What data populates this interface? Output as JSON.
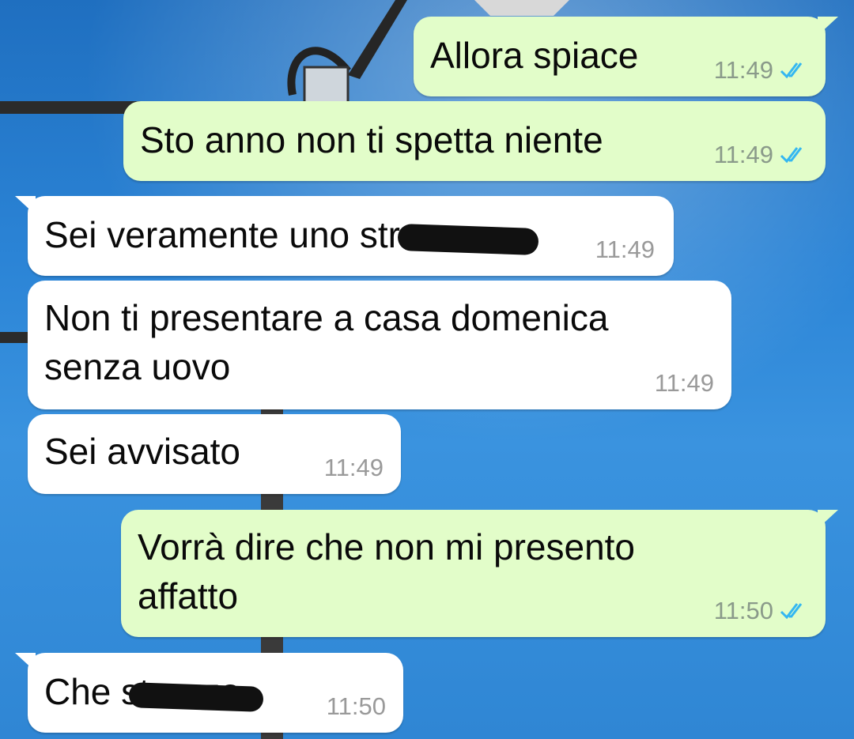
{
  "colors": {
    "outgoing_bubble": "#e2fdc9",
    "incoming_bubble": "#ffffff",
    "read_ticks": "#34b7f1",
    "wallpaper": "#2b84d6"
  },
  "messages": [
    {
      "direction": "out",
      "text": "Allora spiace",
      "time": "11:49",
      "status": "read"
    },
    {
      "direction": "out",
      "text": "Sto anno non ti spetta niente",
      "time": "11:49",
      "status": "read"
    },
    {
      "direction": "in",
      "text": "Sei veramente uno stronzo",
      "time": "11:49",
      "redacted_word": "stronzo"
    },
    {
      "direction": "in",
      "text": "Non ti presentare a casa domenica\nsenza uovo",
      "time": "11:49"
    },
    {
      "direction": "in",
      "text": "Sei avvisato",
      "time": "11:49"
    },
    {
      "direction": "out",
      "text": "Vorrà dire che non mi presento\naffatto",
      "time": "11:50",
      "status": "read"
    },
    {
      "direction": "in",
      "text": "Che stronzo",
      "time": "11:50",
      "redacted_word": "stronzo"
    }
  ],
  "icons": {
    "read_receipt": "double-check-icon"
  }
}
